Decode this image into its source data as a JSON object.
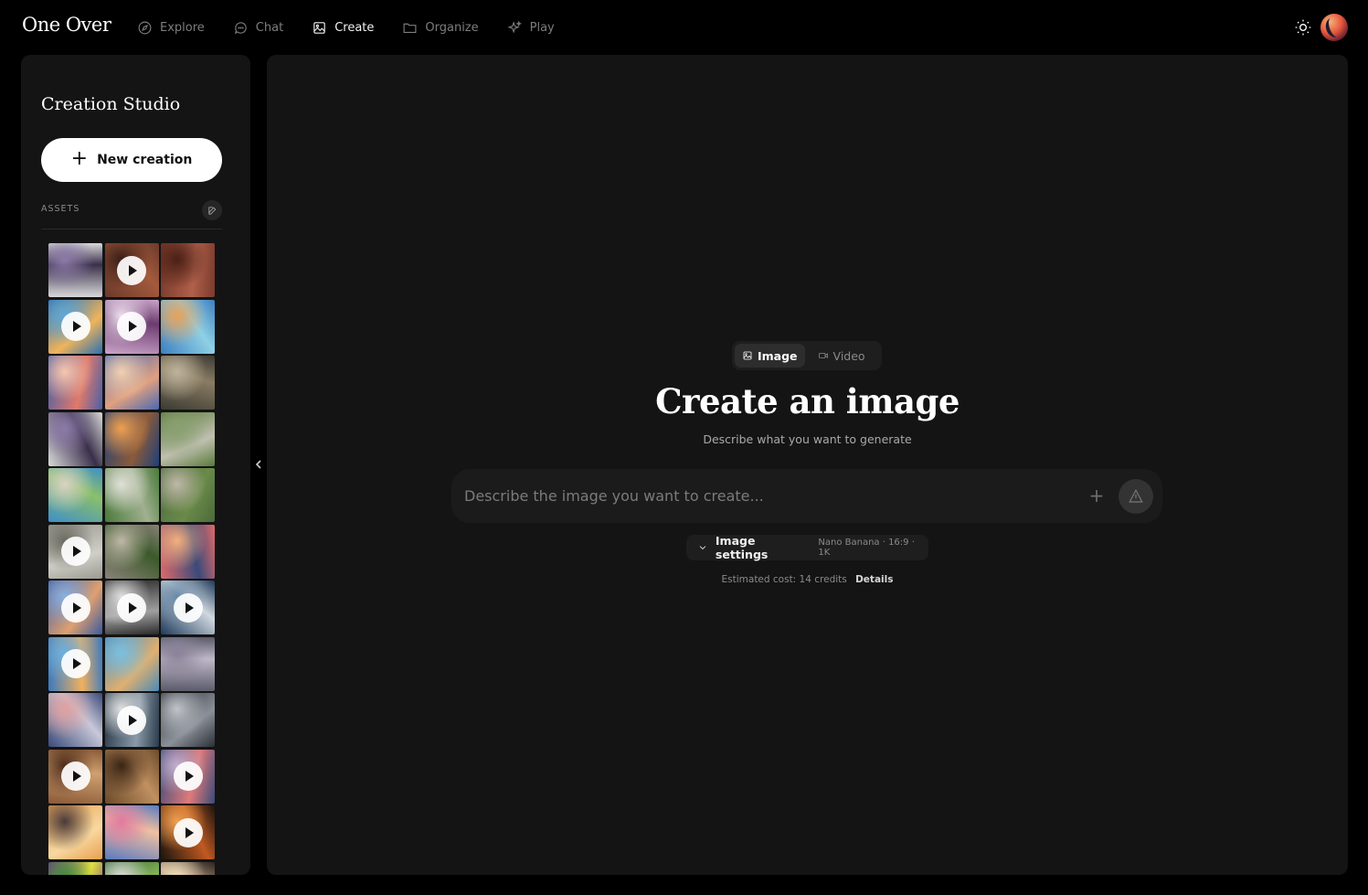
{
  "app": {
    "logo": "One Over"
  },
  "nav": {
    "items": [
      {
        "label": "Explore",
        "icon": "compass-icon",
        "active": false
      },
      {
        "label": "Chat",
        "icon": "chat-bubble-icon",
        "active": false
      },
      {
        "label": "Create",
        "icon": "image-icon",
        "active": true
      },
      {
        "label": "Organize",
        "icon": "folder-icon",
        "active": false
      },
      {
        "label": "Play",
        "icon": "sparkles-icon",
        "active": false
      }
    ]
  },
  "sidebar": {
    "title": "Creation Studio",
    "new_button": "New creation",
    "assets_label": "ASSETS",
    "thumbnails": [
      {
        "palette": [
          "#d9d9d9",
          "#3a2f4a",
          "#8b7aa8"
        ],
        "video": false
      },
      {
        "palette": [
          "#6b3a2a",
          "#a45a3c",
          "#3a1e17"
        ],
        "video": true
      },
      {
        "palette": [
          "#7a3a2b",
          "#b0604a",
          "#4a2016"
        ],
        "video": false
      },
      {
        "palette": [
          "#2b6fb3",
          "#f0b45a",
          "#5fa9d8"
        ],
        "video": true
      },
      {
        "palette": [
          "#c9a3c9",
          "#6b3b6e",
          "#f0e1f0"
        ],
        "video": true
      },
      {
        "palette": [
          "#3d7fc0",
          "#8fd0e6",
          "#e8a25a"
        ],
        "video": false
      },
      {
        "palette": [
          "#4a5fa8",
          "#e07a6a",
          "#f5c7b0"
        ],
        "video": false
      },
      {
        "palette": [
          "#4a68b0",
          "#e0a080",
          "#f2d0b0"
        ],
        "video": false
      },
      {
        "palette": [
          "#3b3b33",
          "#8a7c63",
          "#bdb29a"
        ],
        "video": false
      },
      {
        "palette": [
          "#d9d9d9",
          "#3a2f4a",
          "#8b7aa8"
        ],
        "video": false
      },
      {
        "palette": [
          "#1d3f7a",
          "#8b5a3a",
          "#f0a050"
        ],
        "video": false
      },
      {
        "palette": [
          "#5a7a3a",
          "#c0c0b0",
          "#8aa070"
        ],
        "video": false
      },
      {
        "palette": [
          "#3f8fc8",
          "#8ac06a",
          "#d9d2c4"
        ],
        "video": false
      },
      {
        "palette": [
          "#4a7a3a",
          "#a0b090",
          "#e0e0d8"
        ],
        "video": false
      },
      {
        "palette": [
          "#4a6a3a",
          "#6a8a4a",
          "#c0b8a8"
        ],
        "video": false
      },
      {
        "palette": [
          "#9a9a90",
          "#d0cfc8",
          "#6a6a60"
        ],
        "video": true
      },
      {
        "palette": [
          "#8a8278",
          "#3b5a2a",
          "#c0b8a8"
        ],
        "video": false
      },
      {
        "palette": [
          "#e06a6a",
          "#3a4a7a",
          "#f2b080"
        ],
        "video": false
      },
      {
        "palette": [
          "#3a5aa0",
          "#e0a070",
          "#8ab0e0"
        ],
        "video": true
      },
      {
        "palette": [
          "#2a2a2a",
          "#a0a0a0",
          "#e0e0e0"
        ],
        "video": true
      },
      {
        "palette": [
          "#1e3a5a",
          "#d0d8e0",
          "#6a8aa8"
        ],
        "video": true
      },
      {
        "palette": [
          "#3a7ac0",
          "#f0b060",
          "#6ab0e0"
        ],
        "video": true
      },
      {
        "palette": [
          "#4a8ab8",
          "#e0b070",
          "#7ac0e0"
        ],
        "video": false
      },
      {
        "palette": [
          "#5a5a6a",
          "#c0b8c8",
          "#8a8298"
        ],
        "video": false
      },
      {
        "palette": [
          "#3a4a7a",
          "#c8c8d8",
          "#e0a0a0"
        ],
        "video": false
      },
      {
        "palette": [
          "#2a3a4a",
          "#8a9aa8",
          "#e0e0e0"
        ],
        "video": true
      },
      {
        "palette": [
          "#2a2f38",
          "#8a8f98",
          "#c0c4c8"
        ],
        "video": false
      },
      {
        "palette": [
          "#8a5a38",
          "#d0a070",
          "#4a2a18"
        ],
        "video": true
      },
      {
        "palette": [
          "#6a4a2a",
          "#c09060",
          "#3a2414"
        ],
        "video": false
      },
      {
        "palette": [
          "#3a4a7a",
          "#e07a7a",
          "#c0b0d0"
        ],
        "video": true
      },
      {
        "palette": [
          "#e8a050",
          "#f8d8a0",
          "#4a3a3a"
        ],
        "video": false
      },
      {
        "palette": [
          "#5a7ac0",
          "#f0c0a0",
          "#e07aa0"
        ],
        "video": false
      },
      {
        "palette": [
          "#1a1410",
          "#c05a20",
          "#f0a050"
        ],
        "video": true
      },
      {
        "palette": [
          "#6a3a8a",
          "#e0e040",
          "#3a8a3a"
        ],
        "video": false
      },
      {
        "palette": [
          "#3a6a3a",
          "#a0d060",
          "#e0e0e0"
        ],
        "video": false
      },
      {
        "palette": [
          "#2a2420",
          "#c0a080",
          "#f0e0c0"
        ],
        "video": false
      }
    ]
  },
  "main": {
    "modes": [
      {
        "label": "Image",
        "icon": "image-icon",
        "active": true
      },
      {
        "label": "Video",
        "icon": "video-camera-icon",
        "active": false
      }
    ],
    "heading": "Create an image",
    "subheading": "Describe what you want to generate",
    "prompt": {
      "placeholder": "Describe the image you want to create...",
      "value": ""
    },
    "settings": {
      "label": "Image settings",
      "meta": "Nano Banana · 16:9 · 1K"
    },
    "cost": {
      "text": "Estimated cost: 14 credits",
      "details": "Details"
    }
  },
  "colors": {
    "background": "#000000",
    "panel": "#141414",
    "accent": "#ffffff"
  }
}
